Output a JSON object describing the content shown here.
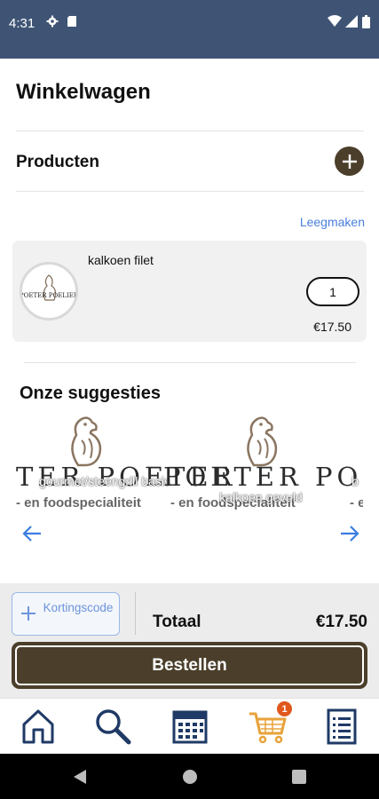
{
  "status_bar": {
    "time": "4:31",
    "icons": [
      "gear-icon",
      "sim-card-icon",
      "wifi-icon",
      "signal-icon",
      "battery-icon"
    ]
  },
  "header": {
    "title": "Winkelwagen"
  },
  "products_section": {
    "label": "Producten",
    "add_icon": "plus-circle-icon"
  },
  "cart": {
    "clear_label": "Leegmaken",
    "items": [
      {
        "name": "kalkoen filet",
        "quantity": "1",
        "price": "€17.50",
        "image_logo_text": "POETER POELIER"
      }
    ]
  },
  "suggestions": {
    "title": "Onze suggesties",
    "items": [
      {
        "label": "gourmet/steengrill basis",
        "logo_word": "TER POETER",
        "logo_sub": "- en foodspecialiteit"
      },
      {
        "label": "kalkoen gevuld",
        "logo_word": "POETER POET",
        "logo_sub": "- en foodspecialiteit"
      },
      {
        "label": "b",
        "logo_word": "",
        "logo_sub": "- e"
      }
    ],
    "prev_icon": "arrow-left-icon",
    "next_icon": "arrow-right-icon"
  },
  "checkout": {
    "coupon_label": "Kortingscode",
    "total_label": "Totaal",
    "total_value": "€17.50",
    "order_label": "Bestellen"
  },
  "tab_bar": {
    "tabs": [
      {
        "name": "home",
        "icon": "home-icon"
      },
      {
        "name": "search",
        "icon": "search-icon"
      },
      {
        "name": "calendar",
        "icon": "calendar-icon"
      },
      {
        "name": "cart",
        "icon": "cart-icon",
        "badge": "1"
      },
      {
        "name": "list",
        "icon": "list-icon"
      }
    ]
  },
  "colors": {
    "brand": "#4b3f2b",
    "status_bar": "#3f5475",
    "link": "#4a7fe0",
    "badge": "#e0581c",
    "cart_active": "#e8a23a",
    "icon_navy": "#1f3a66"
  }
}
